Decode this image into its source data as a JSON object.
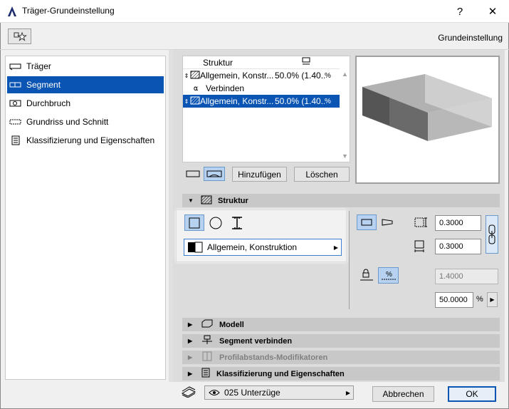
{
  "window": {
    "title": "Träger-Grundeinstellung",
    "help_glyph": "?",
    "close_glyph": "✕"
  },
  "header": {
    "preset_label": "Grundeinstellung"
  },
  "sidebar": {
    "items": [
      {
        "label": "Träger",
        "icon": "beam-icon",
        "selected": false
      },
      {
        "label": "Segment",
        "icon": "segment-icon",
        "selected": true
      },
      {
        "label": "Durchbruch",
        "icon": "hole-icon",
        "selected": false
      },
      {
        "label": "Grundriss und Schnitt",
        "icon": "floorplan-icon",
        "selected": false
      },
      {
        "label": "Klassifizierung und Eigenschaften",
        "icon": "document-icon",
        "selected": false
      }
    ]
  },
  "segment_list": {
    "col_header": "Struktur",
    "rows": [
      {
        "name": "Allgemein, Konstr...",
        "value": "50.0% (1.40...",
        "selected": false
      },
      {
        "name": "Verbinden",
        "value": "",
        "selected": false,
        "type": "joint"
      },
      {
        "name": "Allgemein, Konstr...",
        "value": "50.0% (1.40...",
        "selected": true
      }
    ],
    "add_button": "Hinzufügen",
    "delete_button": "Löschen"
  },
  "sections": {
    "struktur": "Struktur",
    "modell": "Modell",
    "segment_verbinden": "Segment verbinden",
    "profil": "Profilabstands-Modifikatoren",
    "klass": "Klassifizierung und Eigenschaften"
  },
  "struktur": {
    "material": "Allgemein, Konstruktion",
    "width": "0.3000",
    "height": "0.3000",
    "length": "1.4000",
    "percent": "50.0000",
    "percent_unit": "%"
  },
  "footer": {
    "layer": "025 Unterzüge",
    "cancel": "Abbrechen",
    "ok": "OK"
  },
  "colors": {
    "selection": "#0a54b3",
    "accent_light": "#b7d2f1"
  }
}
